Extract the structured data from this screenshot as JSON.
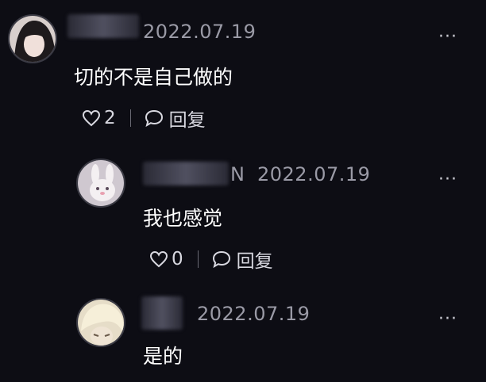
{
  "comments": [
    {
      "date": "2022.07.19",
      "text": "切的不是自己做的",
      "likes": "2",
      "reply_label": "回复",
      "more": "···"
    },
    {
      "name_suffix": "N",
      "date": "2022.07.19",
      "text": "我也感觉",
      "likes": "0",
      "reply_label": "回复",
      "more": "···"
    },
    {
      "date": "2022.07.19",
      "text": "是的",
      "more": "···"
    }
  ]
}
